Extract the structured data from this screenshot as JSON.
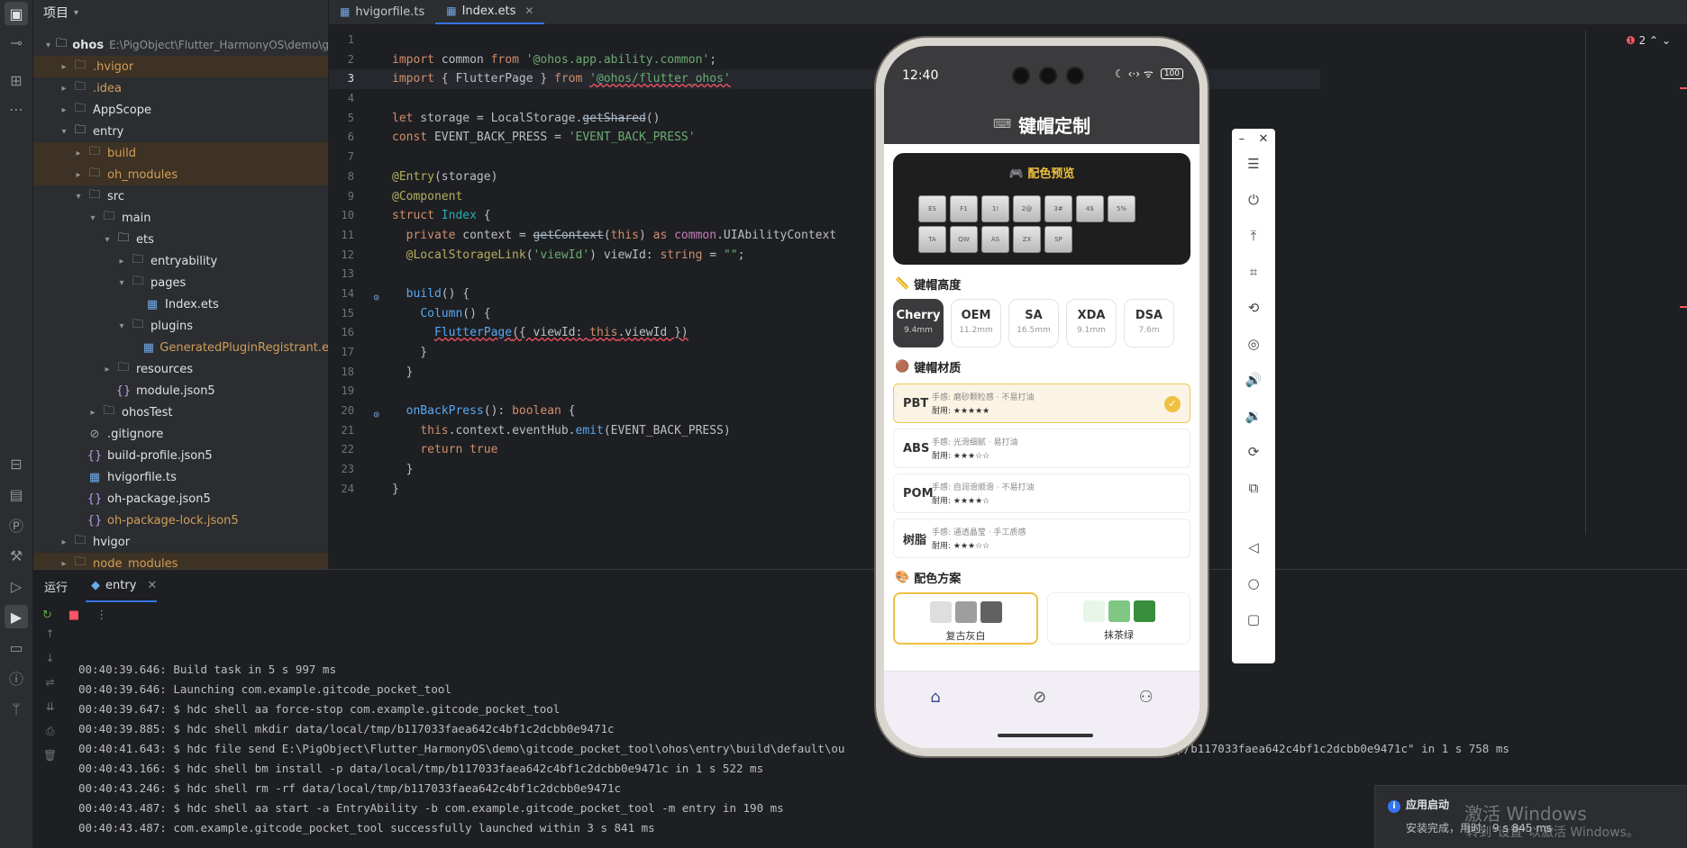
{
  "toolstrip": {
    "icons": [
      "folder-icon",
      "commit-icon",
      "structure-icon",
      "more-icon",
      "bookmarks-icon",
      "tables-icon",
      "profiler-icon",
      "build-icon",
      "services-icon",
      "run-icon",
      "terminal-icon",
      "problems-icon",
      "git-icon"
    ]
  },
  "project": {
    "title": "项目",
    "tree": [
      {
        "label": "ohos",
        "extra": "E:\\PigObject\\Flutter_HarmonyOS\\demo\\g",
        "indent": 0,
        "arrow": "▾",
        "icon": "module",
        "bold": true
      },
      {
        "label": ".hvigor",
        "indent": 1,
        "arrow": "▸",
        "icon": "folder",
        "hl": true,
        "orange": true
      },
      {
        "label": ".idea",
        "indent": 1,
        "arrow": "▸",
        "icon": "folder",
        "orange": true
      },
      {
        "label": "AppScope",
        "indent": 1,
        "arrow": "▸",
        "icon": "folder"
      },
      {
        "label": "entry",
        "indent": 1,
        "arrow": "▾",
        "icon": "module"
      },
      {
        "label": "build",
        "indent": 2,
        "arrow": "▸",
        "icon": "folder",
        "hl": true,
        "orange": true
      },
      {
        "label": "oh_modules",
        "indent": 2,
        "arrow": "▸",
        "icon": "folder",
        "hl": true,
        "orange": true
      },
      {
        "label": "src",
        "indent": 2,
        "arrow": "▾",
        "icon": "folder"
      },
      {
        "label": "main",
        "indent": 3,
        "arrow": "▾",
        "icon": "folder"
      },
      {
        "label": "ets",
        "indent": 4,
        "arrow": "▾",
        "icon": "module"
      },
      {
        "label": "entryability",
        "indent": 5,
        "arrow": "▸",
        "icon": "folder"
      },
      {
        "label": "pages",
        "indent": 5,
        "arrow": "▾",
        "icon": "folder"
      },
      {
        "label": "Index.ets",
        "indent": 6,
        "arrow": "",
        "icon": "ets"
      },
      {
        "label": "plugins",
        "indent": 5,
        "arrow": "▾",
        "icon": "folder"
      },
      {
        "label": "GeneratedPluginRegistrant.e",
        "indent": 6,
        "arrow": "",
        "icon": "ets",
        "orange": true
      },
      {
        "label": "resources",
        "indent": 4,
        "arrow": "▸",
        "icon": "folder"
      },
      {
        "label": "module.json5",
        "indent": 4,
        "arrow": "",
        "icon": "json"
      },
      {
        "label": "ohosTest",
        "indent": 3,
        "arrow": "▸",
        "icon": "folder"
      },
      {
        "label": ".gitignore",
        "indent": 2,
        "arrow": "",
        "icon": "ign"
      },
      {
        "label": "build-profile.json5",
        "indent": 2,
        "arrow": "",
        "icon": "json"
      },
      {
        "label": "hvigorfile.ts",
        "indent": 2,
        "arrow": "",
        "icon": "ets"
      },
      {
        "label": "oh-package.json5",
        "indent": 2,
        "arrow": "",
        "icon": "json"
      },
      {
        "label": "oh-package-lock.json5",
        "indent": 2,
        "arrow": "",
        "icon": "json",
        "orange": true
      },
      {
        "label": "hvigor",
        "indent": 1,
        "arrow": "▸",
        "icon": "folder"
      },
      {
        "label": "node_modules",
        "indent": 1,
        "arrow": "▸",
        "icon": "folder",
        "hl": true,
        "orange": true
      }
    ]
  },
  "editor": {
    "tabs": [
      {
        "label": "hvigorfile.ts",
        "active": false
      },
      {
        "label": "Index.ets",
        "active": true
      }
    ],
    "error_count": "2",
    "current_line": 3,
    "lines": [
      "",
      "<span class=\"kw\">import</span> common <span class=\"kw\">from</span> <span class=\"str\">'@ohos.app.ability.common'</span>;",
      "<span class=\"kw\">import</span> { FlutterPage } <span class=\"kw\">from</span> <span class=\"str err\">'@ohos/flutter_ohos'</span>",
      "",
      "<span class=\"kw\">let</span> storage = LocalStorage.<span class=\"st\">getShared</span>()",
      "<span class=\"kw\">const</span> EVENT_BACK_PRESS = <span class=\"str\">'EVENT_BACK_PRESS'</span>",
      "",
      "<span class=\"an\">@Entry</span>(storage)",
      "<span class=\"an\">@Component</span>",
      "<span class=\"kw\">struct</span> <span class=\"ty\">Index</span> {",
      "  <span class=\"kw\">private</span> context = <span class=\"st\">getContext</span>(<span class=\"kw\">this</span>) <span class=\"kw\">as</span> <span class=\"cls\">common</span>.UIAbilityContext",
      "  <span class=\"an\">@LocalStorageLink</span>(<span class=\"str\">'viewId'</span>) viewId: <span class=\"kw\">string</span> = <span class=\"str\">\"\"</span>;",
      "",
      "  <span class=\"fn\">build</span>() {",
      "    <span class=\"fn\">Column</span>() {",
      "      <span class=\"fn err\">FlutterPage</span><span class=\"err\">({ viewId: <span class=\"kw\">this</span>.viewId })</span>",
      "    }",
      "  }",
      "",
      "  <span class=\"fn\">onBackPress</span>(): <span class=\"kw\">boolean</span> {",
      "    <span class=\"kw\">this</span>.context.eventHub.<span class=\"fn\">emit</span>(EVENT_BACK_PRESS)",
      "    <span class=\"kw\">return</span> <span class=\"kw\">true</span>",
      "  }",
      "}"
    ]
  },
  "run": {
    "title": "运行",
    "tab": "entry",
    "log": [
      "00:40:39.646: Build task in 5 s 997 ms",
      "00:40:39.646: Launching com.example.gitcode_pocket_tool",
      "00:40:39.647: $ hdc shell aa force-stop com.example.gitcode_pocket_tool",
      "00:40:39.885: $ hdc shell mkdir data/local/tmp/b117033faea642c4bf1c2dcbb0e9471c",
      "00:40:41.643: $ hdc file send E:\\PigObject\\Flutter_HarmonyOS\\demo\\gitcode_pocket_tool\\ohos\\entry\\build\\default\\ou                                    data/local/tmp/b117033faea642c4bf1c2dcbb0e9471c\" in 1 s 758 ms",
      "00:40:43.166: $ hdc shell bm install -p data/local/tmp/b117033faea642c4bf1c2dcbb0e9471c in 1 s 522 ms",
      "00:40:43.246: $ hdc shell rm -rf data/local/tmp/b117033faea642c4bf1c2dcbb0e9471c",
      "00:40:43.487: $ hdc shell aa start -a EntryAbility -b com.example.gitcode_pocket_tool -m entry in 190 ms",
      "00:40:43.487: com.example.gitcode_pocket_tool successfully launched within 3 s 841 ms"
    ]
  },
  "phone": {
    "time": "12:40",
    "battery": "100",
    "status_icons": "☾ ‹·› ᯤ",
    "title": "键帽定制",
    "keyboard_icon": "⌨",
    "preview": {
      "title": "🎮 配色预览",
      "keys": [
        "ES",
        "F1",
        "1!",
        "2@",
        "3#",
        "4$",
        "5%",
        "TA",
        "QW",
        "AS",
        "ZX",
        "SP"
      ]
    },
    "heights": {
      "title": "键帽高度",
      "icon": "📏",
      "items": [
        {
          "name": "Cherry",
          "size": "9.4mm",
          "on": true
        },
        {
          "name": "OEM",
          "size": "11.2mm"
        },
        {
          "name": "SA",
          "size": "16.5mm"
        },
        {
          "name": "XDA",
          "size": "9.1mm"
        },
        {
          "name": "DSA",
          "size": "7.6m"
        }
      ]
    },
    "materials": {
      "title": "键帽材质",
      "icon": "🟤",
      "items": [
        {
          "name": "PBT",
          "desc": "手感: 磨砂颗粒感 · 不易打油",
          "dur": "耐用: ★★★★★",
          "on": true
        },
        {
          "name": "ABS",
          "desc": "手感: 光滑细腻 · 易打油",
          "dur": "耐用: ★★★☆☆"
        },
        {
          "name": "POM",
          "desc": "手感: 自润滑顺滑 · 不易打油",
          "dur": "耐用: ★★★★☆"
        },
        {
          "name": "树脂",
          "desc": "手感: 通透晶莹 · 手工质感",
          "dur": "耐用: ★★★☆☆"
        }
      ]
    },
    "schemes": {
      "title": "配色方案",
      "icon": "🎨",
      "items": [
        {
          "name": "复古灰白",
          "colors": [
            "#dedede",
            "#9e9e9e",
            "#616161"
          ],
          "on": true
        },
        {
          "name": "抹茶绿",
          "colors": [
            "#e8f5e9",
            "#81c784",
            "#388e3c"
          ]
        }
      ]
    },
    "nav": [
      "⌂",
      "⊘",
      "⚇"
    ]
  },
  "emulator": {
    "top": [
      "–",
      "✕"
    ],
    "buttons": [
      "menu-icon",
      "power-icon",
      "top-icon",
      "crop-icon",
      "rotate-icon",
      "screenshot-icon",
      "volume-up-icon",
      "volume-down-icon",
      "shake-icon",
      "multi-screen-icon",
      "back-icon",
      "home-icon",
      "recent-icon"
    ],
    "glyphs": [
      "☰",
      "⏻",
      "⤒",
      "⌗",
      "⟲",
      "◎",
      "🔊",
      "🔉",
      "⟳",
      "⧉",
      "◁",
      "○",
      "▢"
    ]
  },
  "notification": {
    "title": "应用启动",
    "body": "安装完成，用时：9 s 845 ms"
  },
  "watermark": {
    "line1": "激活 Windows",
    "line2": "转到\"设置\"以激活 Windows。"
  }
}
